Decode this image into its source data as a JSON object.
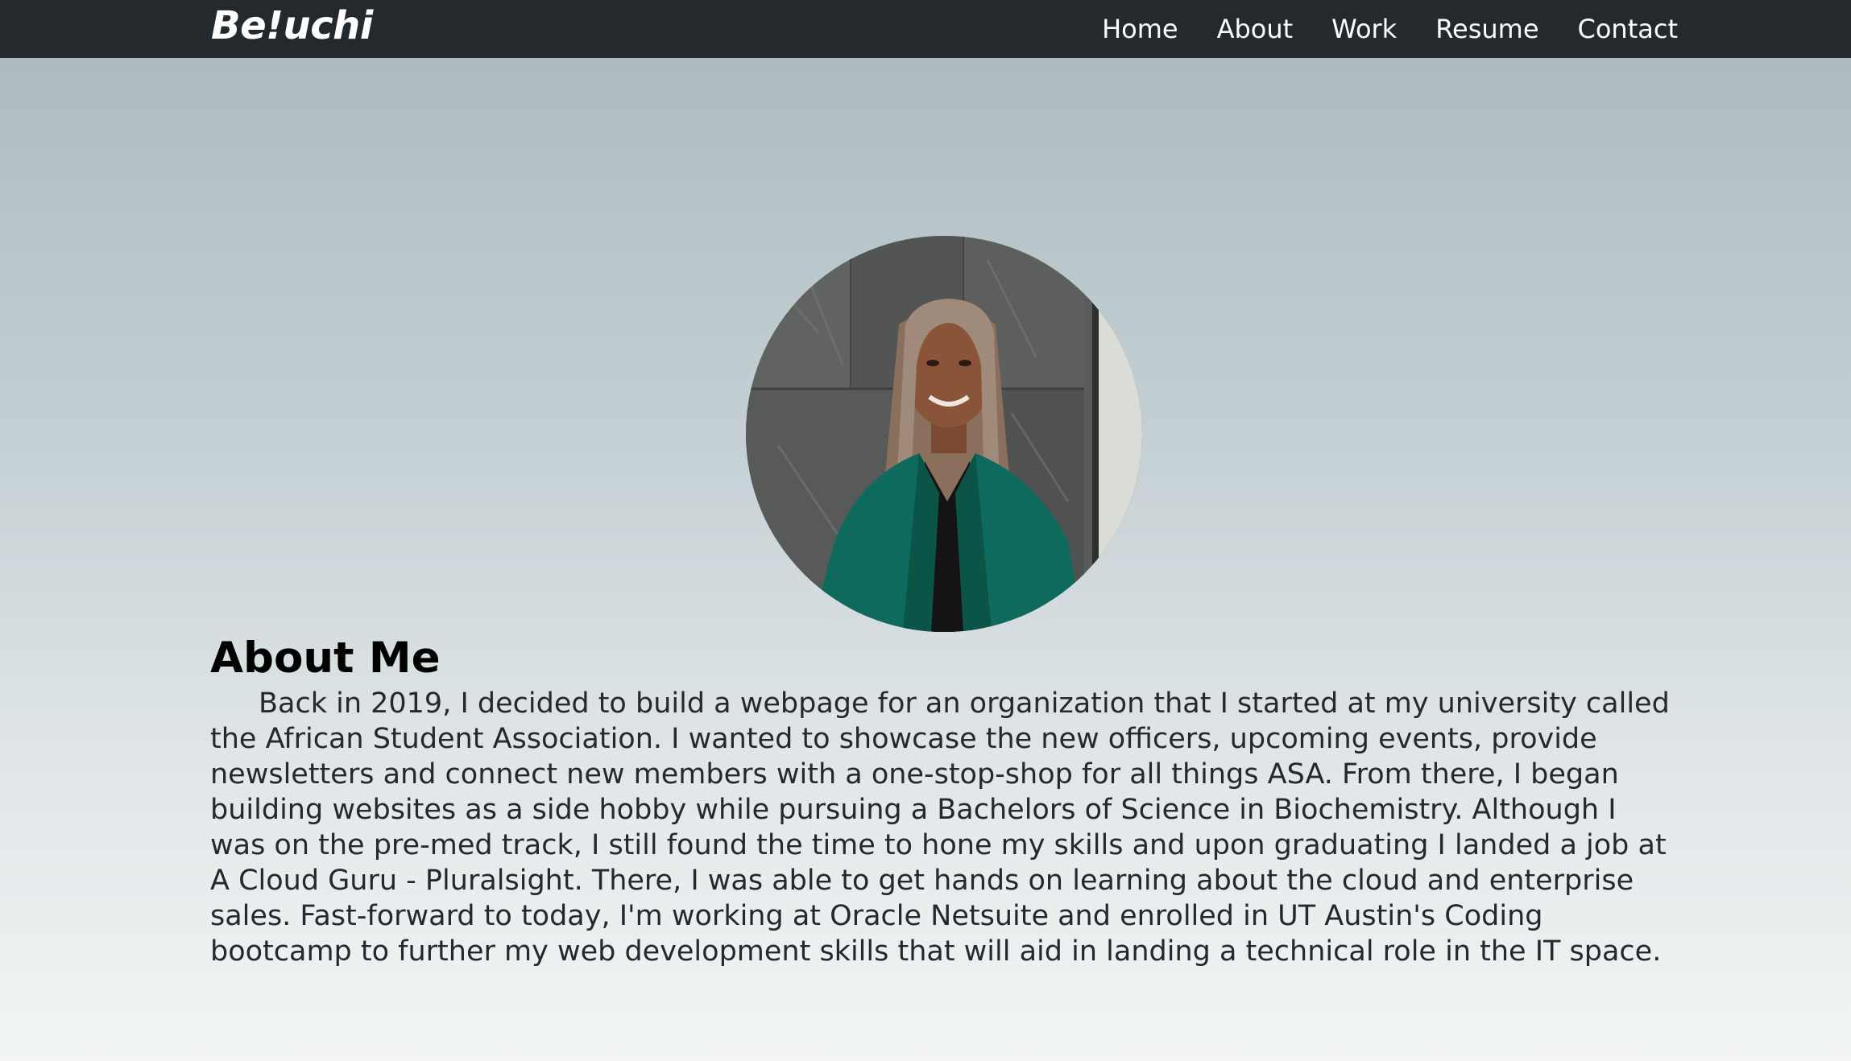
{
  "nav": {
    "brand": "Be!uchi",
    "links": [
      {
        "label": "Home"
      },
      {
        "label": "About"
      },
      {
        "label": "Work"
      },
      {
        "label": "Resume"
      },
      {
        "label": "Contact"
      }
    ]
  },
  "about": {
    "title": "About Me",
    "body": "Back in 2019, I decided to build a webpage for an organization that I started at my university called the African Student Association. I wanted to showcase the new officers, upcoming events, provide newsletters and connect new members with a one-stop-shop for all things ASA. From there, I began building websites as a side hobby while pursuing a Bachelors of Science in Biochemistry. Although I was on the pre-med track, I still found the time to hone my skills and upon graduating I landed a job at A Cloud Guru - Pluralsight. There, I was able to get hands on learning about the cloud and enterprise sales. Fast-forward to today, I'm working at Oracle Netsuite and enrolled in UT Austin's Coding bootcamp to further my web development skills that will aid in landing a technical role in the IT space."
  },
  "colors": {
    "navbar": "#23292d",
    "nav_text": "#ffffff",
    "gradient_top": "#aab9be",
    "gradient_bottom": "#f3f5f5",
    "jacket": "#0f6a5e"
  }
}
